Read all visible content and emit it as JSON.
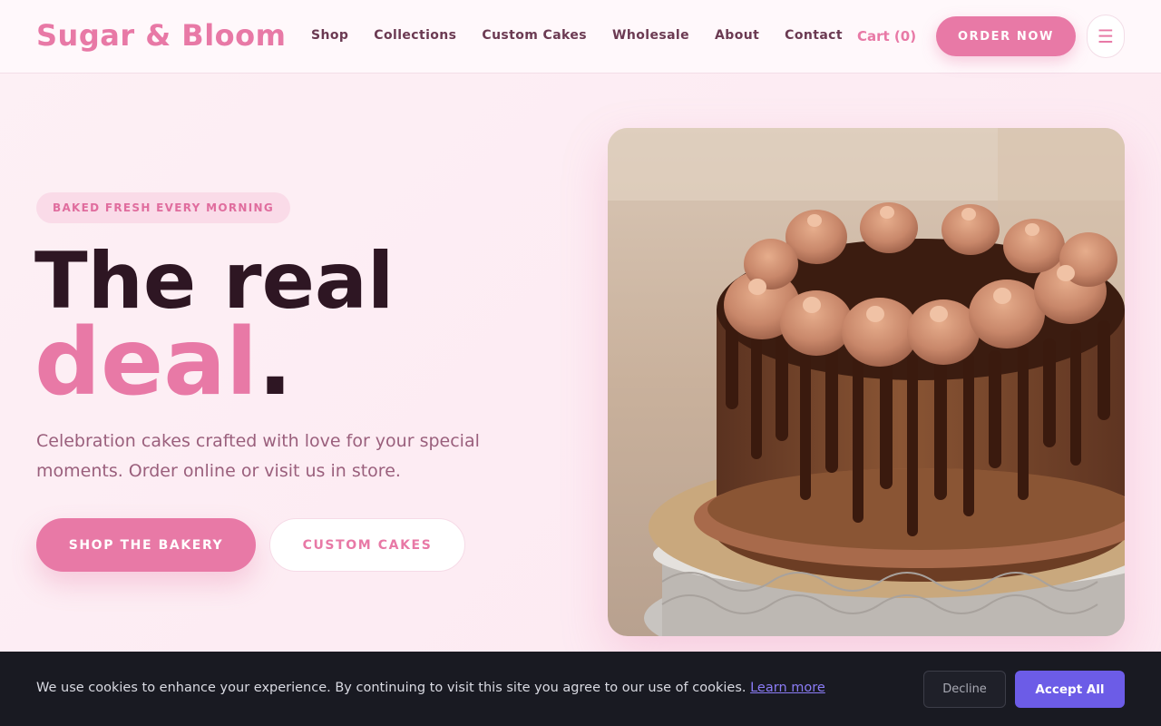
{
  "header": {
    "logo": "Sugar & Bloom",
    "nav": [
      "Shop",
      "Collections",
      "Custom Cakes",
      "Wholesale",
      "About",
      "Contact"
    ],
    "cart_label": "Cart (0)",
    "order_label": "ORDER NOW",
    "menu_icon": "hamburger-menu-icon"
  },
  "hero": {
    "badge": "BAKED FRESH EVERY MORNING",
    "headline_line1": "The real",
    "headline_line2": "deal",
    "headline_dot": ".",
    "subtext": "Celebration cakes crafted with love for your special moments. Order online or visit us in store.",
    "primary_cta": "SHOP THE BAKERY",
    "secondary_cta": "CUSTOM CAKES",
    "image_subject": "chocolate-drip-cake-photo"
  },
  "cookie_banner": {
    "message": "We use cookies to enhance your experience. By continuing to visit this site you agree to our use of cookies.",
    "link_label": "Learn more",
    "decline_label": "Decline",
    "accept_label": "Accept All"
  },
  "colors": {
    "brand_pink": "#e879a6",
    "dark_text": "#2e1623",
    "cookie_bg": "#191a22",
    "accept_purple": "#6c5ce7"
  }
}
